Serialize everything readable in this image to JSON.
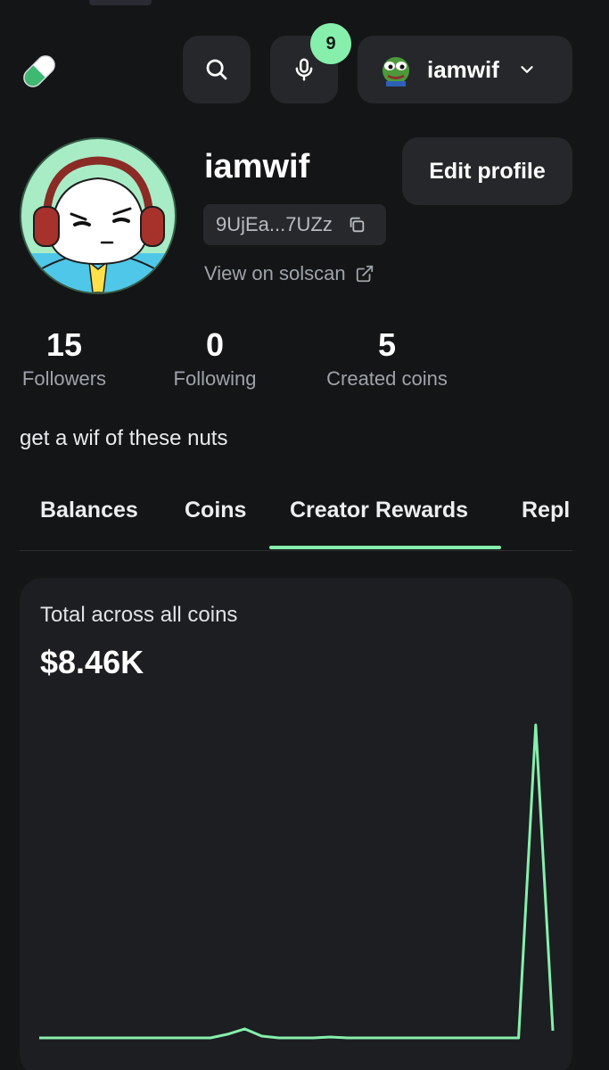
{
  "header": {
    "notification_count": "9",
    "username": "iamwif",
    "icons": {
      "logo": "pill-logo-icon",
      "search": "search-icon",
      "mic": "microphone-icon",
      "user_avatar": "pepe-avatar-icon",
      "dropdown": "chevron-down-icon"
    }
  },
  "profile": {
    "name": "iamwif",
    "address": "9UjEa...7UZz",
    "solscan_label": "View on solscan",
    "edit_label": "Edit profile",
    "bio": "get a wif of these nuts"
  },
  "stats": [
    {
      "value": "15",
      "label": "Followers"
    },
    {
      "value": "0",
      "label": "Following"
    },
    {
      "value": "5",
      "label": "Created coins"
    }
  ],
  "tabs": [
    {
      "label": "Balances",
      "active": false
    },
    {
      "label": "Coins",
      "active": false
    },
    {
      "label": "Creator Rewards",
      "active": true
    },
    {
      "label": "Repl",
      "active": false
    }
  ],
  "rewards_card": {
    "label": "Total across all coins",
    "value": "$8.46K"
  },
  "chart_data": {
    "type": "line",
    "color": "#86efac",
    "values": [
      0.2,
      0.2,
      0.2,
      0.2,
      0.2,
      0.2,
      0.2,
      0.2,
      0.2,
      0.2,
      0.2,
      0.6,
      1.2,
      0.4,
      0.2,
      0.2,
      0.2,
      0.3,
      0.2,
      0.2,
      0.2,
      0.2,
      0.2,
      0.2,
      0.2,
      0.2,
      0.2,
      0.2,
      0.2,
      35.0,
      1.0
    ]
  },
  "colors": {
    "accent": "#86efac",
    "background": "#141516",
    "surface": "#25272a"
  }
}
